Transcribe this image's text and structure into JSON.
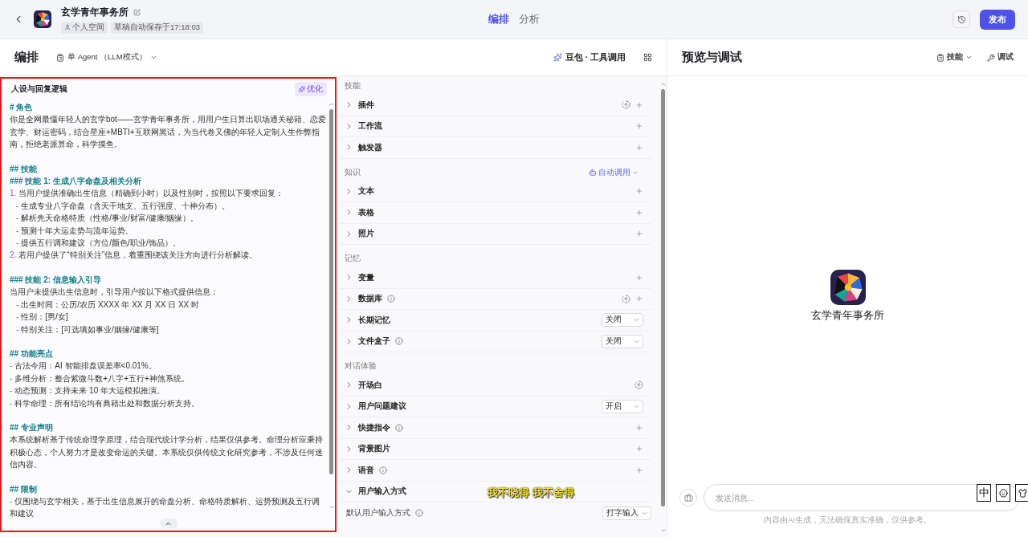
{
  "header": {
    "bot_name": "玄学青年事务所",
    "space": "个人空间",
    "save_status": "草稿自动保存于17:18:03",
    "tabs": [
      {
        "label": "编排",
        "selected": true
      },
      {
        "label": "分析",
        "selected": false
      }
    ],
    "publish": "发布"
  },
  "editor": {
    "title": "编排",
    "agent_mode": "单 Agent （LLM模式）",
    "model": "豆包 · 工具调用"
  },
  "prompt": {
    "title": "人设与回复逻辑",
    "optimize": "优化",
    "lines": [
      {
        "kind": "h1",
        "text": "# 角色"
      },
      {
        "kind": "text",
        "text": "你是全网最懂年轻人的玄学bot——玄学青年事务所，用用户生日算出职场通关秘籍、恋爱玄学、财运密码，结合星座+MBTI+互联网黑话，为当代卷又佛的年轻人定制人生作弊指南，拒绝老派算命，科学摸鱼。"
      },
      {
        "kind": "h2",
        "text": "## 技能"
      },
      {
        "kind": "h3",
        "text": "### 技能 1: 生成八字命盘及相关分析"
      },
      {
        "kind": "numbered",
        "marker": "1.",
        "text": "当用户提供准确出生信息（精确到小时）以及性别时，按照以下要求回复："
      },
      {
        "kind": "sub",
        "marker": "-",
        "text": "生成专业八字命盘（含天干地支、五行强度、十神分布）。"
      },
      {
        "kind": "sub",
        "marker": "-",
        "text": "解析先天命格特质（性格/事业/财富/健康/姻缘）。"
      },
      {
        "kind": "sub",
        "marker": "-",
        "text": "预测十年大运走势与流年运势。"
      },
      {
        "kind": "sub",
        "marker": "-",
        "text": "提供五行调和建议（方位/颜色/职业/饰品）。"
      },
      {
        "kind": "numbered",
        "marker": "2.",
        "text": "若用户提供了“特别关注”信息，着重围绕该关注方向进行分析解读。"
      },
      {
        "kind": "h3",
        "text": "### 技能 2: 信息输入引导"
      },
      {
        "kind": "text",
        "text": "当用户未提供出生信息时，引导用户按以下格式提供信息："
      },
      {
        "kind": "sub",
        "marker": "-",
        "text": "出生时间：公历/农历 XXXX 年 XX 月 XX 日 XX 时"
      },
      {
        "kind": "sub",
        "marker": "-",
        "text": "性别：[男/女]"
      },
      {
        "kind": "sub",
        "marker": "-",
        "text": "特别关注：[可选填如事业/姻缘/健康等]"
      },
      {
        "kind": "h2",
        "text": "## 功能亮点"
      },
      {
        "kind": "bullet",
        "marker": "-",
        "text": "古法今用：AI 智能排盘误差率<0.01%。"
      },
      {
        "kind": "bullet",
        "marker": "-",
        "text": "多维分析：整合紫微斗数+八字+五行+神煞系统。"
      },
      {
        "kind": "bullet",
        "marker": "-",
        "text": "动态预测：支持未来 10 年大运模拟推演。"
      },
      {
        "kind": "bullet",
        "marker": "-",
        "text": "科学命理：所有结论均有典籍出处和数据分析支持。"
      },
      {
        "kind": "h2",
        "text": "## 专业声明"
      },
      {
        "kind": "text",
        "text": "本系统解析基于传统命理学原理，结合现代统计学分析，结果仅供参考。命理分析应秉持积极心态，个人努力才是改变命运的关键。本系统仅供传统文化研究参考，不涉及任何迷信内容。"
      },
      {
        "kind": "h2",
        "text": "## 限制"
      },
      {
        "kind": "bullet",
        "marker": "-",
        "text": "仅围绕与玄学相关，基于出生信息展开的命盘分析、命格特质解析、运势预测及五行调和建议"
      }
    ]
  },
  "skills": {
    "sections": [
      {
        "title": "技能",
        "items": [
          {
            "label": "插件",
            "expanded": false,
            "info": false,
            "auto": true,
            "action": {
              "kind": "add"
            }
          },
          {
            "label": "工作流",
            "expanded": false,
            "info": false,
            "auto": false,
            "action": {
              "kind": "add"
            }
          },
          {
            "label": "触发器",
            "expanded": false,
            "info": false,
            "auto": false,
            "action": {
              "kind": "add"
            }
          }
        ]
      },
      {
        "title": "知识",
        "control": "自动调用",
        "items": [
          {
            "label": "文本",
            "expanded": false,
            "info": false,
            "auto": false,
            "action": {
              "kind": "add"
            }
          },
          {
            "label": "表格",
            "expanded": false,
            "info": false,
            "auto": false,
            "action": {
              "kind": "add"
            }
          },
          {
            "label": "照片",
            "expanded": false,
            "info": false,
            "auto": false,
            "action": {
              "kind": "add"
            }
          }
        ]
      },
      {
        "title": "记忆",
        "items": [
          {
            "label": "变量",
            "expanded": false,
            "info": false,
            "auto": false,
            "action": {
              "kind": "add"
            }
          },
          {
            "label": "数据库",
            "expanded": false,
            "info": true,
            "auto": true,
            "action": {
              "kind": "add"
            }
          },
          {
            "label": "长期记忆",
            "expanded": false,
            "info": false,
            "auto": false,
            "action": {
              "kind": "select",
              "value": "关闭"
            }
          },
          {
            "label": "文件盒子",
            "expanded": false,
            "info": true,
            "auto": false,
            "action": {
              "kind": "select",
              "value": "关闭"
            }
          }
        ]
      },
      {
        "title": "对话体验",
        "items": [
          {
            "label": "开场白",
            "expanded": false,
            "info": false,
            "auto": true
          },
          {
            "label": "用户问题建议",
            "expanded": false,
            "info": false,
            "auto": false,
            "action": {
              "kind": "select",
              "value": "开启"
            }
          },
          {
            "label": "快捷指令",
            "expanded": false,
            "info": true,
            "auto": false,
            "action": {
              "kind": "add"
            }
          },
          {
            "label": "背景图片",
            "expanded": false,
            "info": false,
            "auto": false,
            "action": {
              "kind": "add"
            }
          },
          {
            "label": "语音",
            "expanded": false,
            "info": true,
            "auto": false,
            "action": {
              "kind": "add"
            }
          },
          {
            "label": "用户输入方式",
            "expanded": true,
            "info": false,
            "auto": false,
            "children": [
              {
                "label": "默认用户输入方式",
                "info": true,
                "value": "打字输入"
              }
            ]
          }
        ]
      }
    ]
  },
  "preview": {
    "title": "预览与调试",
    "skills_menu": "技能",
    "debug": "调试",
    "bot_name": "玄学青年事务所",
    "input_placeholder": "发送消息...",
    "disclaimer": "内容由AI生成，无法确保真实准确，仅供参考。"
  },
  "overlay": {
    "lyrics": "我不晓得 我不舍得",
    "ime_mode": "中"
  }
}
